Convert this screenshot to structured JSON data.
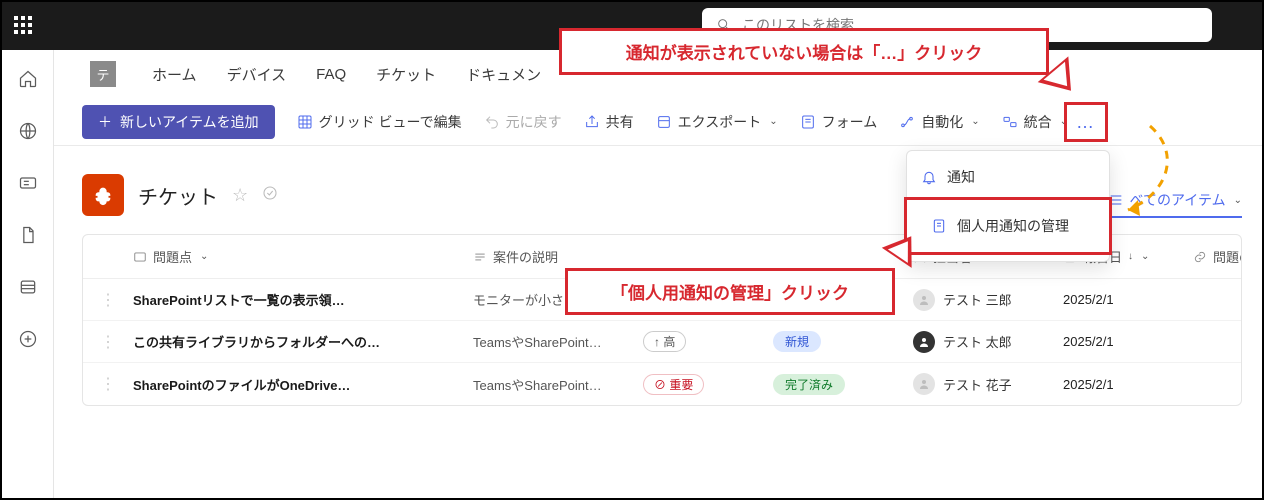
{
  "search": {
    "placeholder": "このリストを検索"
  },
  "sitenav": {
    "logo_letter": "テ",
    "items": [
      "ホーム",
      "デバイス",
      "FAQ",
      "チケット",
      "ドキュメン"
    ]
  },
  "commands": {
    "new_item": "新しいアイテムを追加",
    "grid_edit": "グリッド ビューで編集",
    "undo": "元に戻す",
    "share": "共有",
    "export": "エクスポート",
    "form": "フォーム",
    "automate": "自動化",
    "integrate": "統合",
    "more": "…"
  },
  "overflow_menu": {
    "notify": "通知",
    "manage_personal": "個人用通知の管理"
  },
  "list": {
    "title": "チケット",
    "view_label": "べてのアイテム"
  },
  "columns": {
    "issue": "問題点",
    "description": "案件の説明",
    "priority_hidden": "",
    "status_hidden": "",
    "assignee": "担当者",
    "report_date": "報告日",
    "source": "問題のソー"
  },
  "rows": [
    {
      "title": "SharePointリストで一覧の表示領…",
      "desc": "モニターが小さく…",
      "priority": "",
      "status": "",
      "status_class": "status-active",
      "avatar": "empty",
      "assignee": "テスト 三郎",
      "date": "2025/2/1"
    },
    {
      "title": "この共有ライブラリからフォルダーへの…",
      "desc": "TeamsやSharePoint…",
      "priority": "↑ 高",
      "status": "新規",
      "status_class": "status-new",
      "avatar": "solid",
      "assignee": "テスト 太郎",
      "date": "2025/2/1"
    },
    {
      "title": "SharePointのファイルがOneDrive…",
      "desc": "TeamsやSharePoint…",
      "priority": "⊘ 重要",
      "status": "完了済み",
      "status_class": "status-done",
      "avatar": "empty",
      "assignee": "テスト 花子",
      "date": "2025/2/1"
    }
  ],
  "callouts": {
    "c1": "通知が表示されていない場合は「…」クリック",
    "c2": "「個人用通知の管理」クリック"
  }
}
